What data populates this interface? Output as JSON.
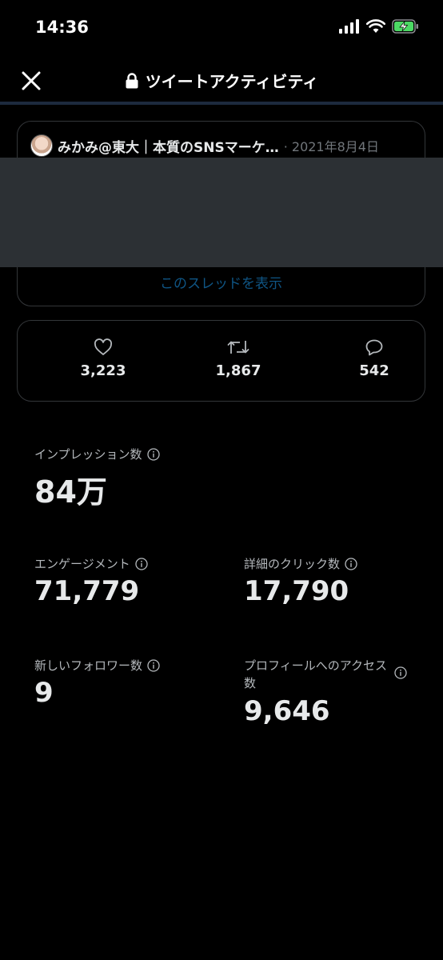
{
  "status_bar": {
    "time": "14:36"
  },
  "header": {
    "title": "ツイートアクティビティ"
  },
  "tweet": {
    "author": "みかみ@東大｜本質のSNSマーケ…",
    "date": "· 2021年8月4日",
    "thread_link": "このスレッドを表示"
  },
  "stats": {
    "likes": "3,223",
    "retweets": "1,867",
    "replies": "542"
  },
  "metrics": {
    "impressions": {
      "label": "インプレッション数",
      "value": "84万"
    },
    "engagements": {
      "label": "エンゲージメント",
      "value": "71,779"
    },
    "detail_clicks": {
      "label": "詳細のクリック数",
      "value": "17,790"
    },
    "new_followers": {
      "label": "新しいフォロワー数",
      "value": "9"
    },
    "profile_visits": {
      "label": "プロフィールへのアクセス数",
      "value": "9,646"
    }
  },
  "colors": {
    "background": "#000000",
    "accent": "#1d9bf0",
    "battery_charge": "#4cd964",
    "redaction": "#2c3034"
  }
}
